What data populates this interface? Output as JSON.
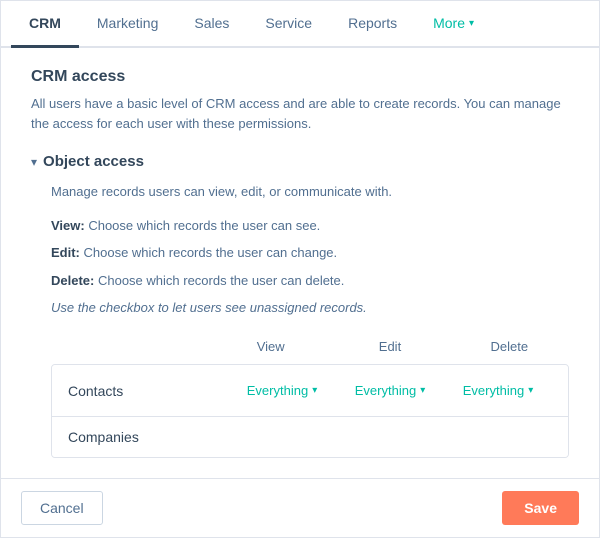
{
  "tabs": [
    {
      "id": "crm",
      "label": "CRM",
      "active": true
    },
    {
      "id": "marketing",
      "label": "Marketing",
      "active": false
    },
    {
      "id": "sales",
      "label": "Sales",
      "active": false
    },
    {
      "id": "service",
      "label": "Service",
      "active": false
    },
    {
      "id": "reports",
      "label": "Reports",
      "active": false
    },
    {
      "id": "more",
      "label": "More",
      "active": false,
      "hasArrow": true
    }
  ],
  "crm_access": {
    "title": "CRM access",
    "description": "All users have a basic level of CRM access and are able to create records. You can manage the access for each user with these permissions."
  },
  "object_access": {
    "title": "Object access",
    "manage_text": "Manage records users can view, edit, or communicate with.",
    "view_line_label": "View:",
    "view_line_text": " Choose which records the user can see.",
    "edit_line_label": "Edit:",
    "edit_line_text": " Choose which records the user can change.",
    "delete_line_label": "Delete:",
    "delete_line_text": " Choose which records the user can delete.",
    "note": "Use the checkbox to let users see unassigned records."
  },
  "table": {
    "headers": [
      "",
      "View",
      "Edit",
      "Delete"
    ],
    "rows": [
      {
        "label": "Contacts",
        "view": "Everything",
        "edit": "Everything",
        "delete": "Everything"
      },
      {
        "label": "Companies",
        "view": "",
        "edit": "",
        "delete": ""
      }
    ]
  },
  "footer": {
    "cancel_label": "Cancel",
    "save_label": "Save"
  }
}
